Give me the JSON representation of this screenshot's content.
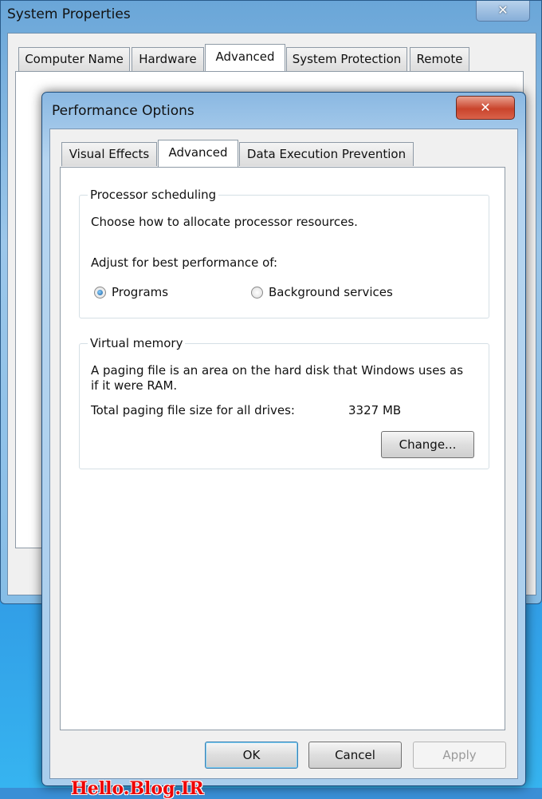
{
  "system_properties": {
    "title": "System Properties",
    "close_icon": "close-icon",
    "tabs": [
      {
        "label": "Computer Name"
      },
      {
        "label": "Hardware"
      },
      {
        "label": "Advanced",
        "selected": true
      },
      {
        "label": "System Protection"
      },
      {
        "label": "Remote"
      }
    ]
  },
  "performance_options": {
    "title": "Performance Options",
    "close_icon": "close-icon",
    "tabs": [
      {
        "label": "Visual Effects"
      },
      {
        "label": "Advanced",
        "selected": true
      },
      {
        "label": "Data Execution Prevention"
      }
    ],
    "processor_scheduling": {
      "legend": "Processor scheduling",
      "description": "Choose how to allocate processor resources.",
      "adjust_label": "Adjust for best performance of:",
      "options": [
        {
          "label": "Programs",
          "selected": true
        },
        {
          "label": "Background services",
          "selected": false
        }
      ]
    },
    "virtual_memory": {
      "legend": "Virtual memory",
      "description_line1": "A paging file is an area on the hard disk that Windows uses as",
      "description_line2": "if it were RAM.",
      "total_label": "Total paging file size for all drives:",
      "total_value": "3327 MB",
      "change_button": "Change..."
    },
    "buttons": {
      "ok": "OK",
      "cancel": "Cancel",
      "apply": "Apply"
    },
    "watermark": "Hello.Blog.IR",
    "colors": {
      "accent": "#3c7fb1",
      "close_red": "#c9442c",
      "watermark": "#e00000"
    }
  }
}
